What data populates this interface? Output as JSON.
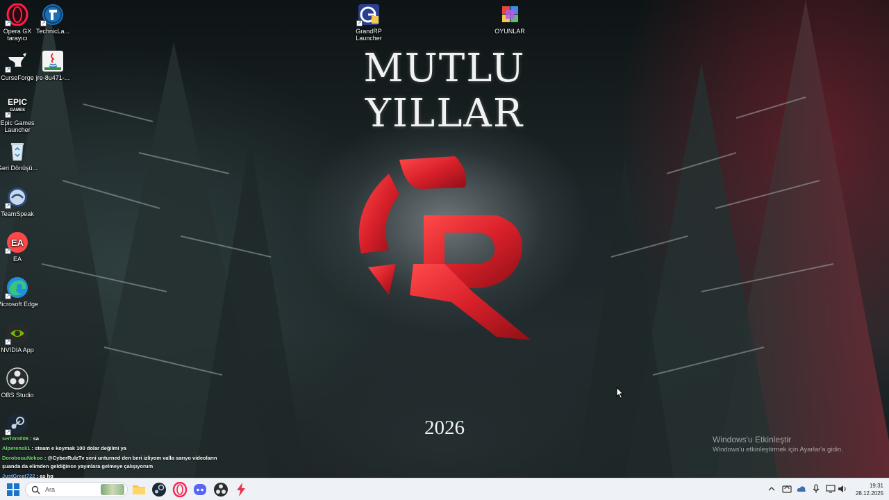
{
  "wallpaper": {
    "headline": "MUTLU YILLAR",
    "year": "2026",
    "accent_red": "#d8202a"
  },
  "desktop": {
    "icons": [
      {
        "label": "Opera GX tarayıcı",
        "icon": "opera-gx-icon"
      },
      {
        "label": "TechnicLa...",
        "icon": "technic-launcher-icon"
      },
      {
        "label": "CurseForge",
        "icon": "curseforge-icon"
      },
      {
        "label": "jre-8u471-...",
        "icon": "java-installer-icon"
      },
      {
        "label": "Epic Games Launcher",
        "icon": "epic-games-icon"
      },
      {
        "label": "Geri Dönüşü...",
        "icon": "recycle-bin-icon"
      },
      {
        "label": "TeamSpeak",
        "icon": "teamspeak-icon"
      },
      {
        "label": "EA",
        "icon": "ea-icon"
      },
      {
        "label": "Microsoft Edge",
        "icon": "edge-icon"
      },
      {
        "label": "NVIDIA App",
        "icon": "nvidia-icon"
      },
      {
        "label": "OBS Studio",
        "icon": "obs-icon"
      },
      {
        "label": "",
        "icon": "steam-icon"
      },
      {
        "label": "GrandRP Launcher",
        "icon": "grandrp-launcher-icon"
      },
      {
        "label": "OYUNLAR",
        "icon": "folder-oyunlar-icon"
      }
    ]
  },
  "chat": {
    "messages": [
      {
        "user": "serhtmtl06",
        "text": " : sa"
      },
      {
        "user": "Alperensk1",
        "text": " : steam e koymak 100 dolar değilmi ya"
      },
      {
        "user": "DorobouuNekoo",
        "text": " : @CyberRulzTv seni unturned den beri izliyom valla sarıyo videoların şuanda da elimden geldiğince yayınlara gelmeye çalışıyorum"
      },
      {
        "user": "JustGreat722",
        "text": " : as hg"
      }
    ]
  },
  "activation": {
    "title": "Windows'u Etkinleştir",
    "subtitle": "Windows'u etkinleştirmek için Ayarlar'a gidin."
  },
  "taskbar": {
    "search_placeholder": "Ara",
    "apps": [
      "file-explorer-icon",
      "steam-icon",
      "opera-gx-icon",
      "discord-icon",
      "obs-icon",
      "power-app-icon"
    ],
    "tray": [
      "chevron-up-icon",
      "sync-icon",
      "network-cloud-icon",
      "microphone-icon",
      "display-icon",
      "speaker-icon"
    ],
    "time": "19:31",
    "date": "28.12.2025"
  }
}
